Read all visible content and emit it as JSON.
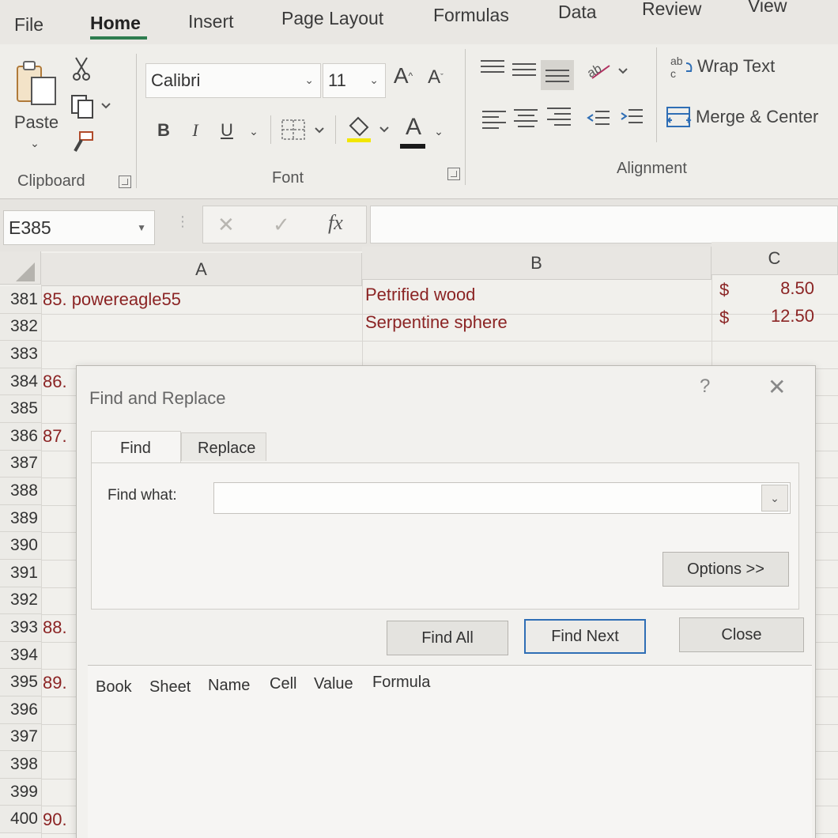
{
  "ribbon_tabs": [
    "File",
    "Home",
    "Insert",
    "Page Layout",
    "Formulas",
    "Data",
    "Review",
    "View"
  ],
  "clipboard": {
    "paste_label": "Paste",
    "group_label": "Clipboard"
  },
  "font": {
    "name": "Calibri",
    "size": "11",
    "bold": "B",
    "italic": "I",
    "underline": "U",
    "font_color_letter": "A",
    "grow_label": "A",
    "shrink_label": "A",
    "group_label": "Font"
  },
  "alignment": {
    "wrap_text": "Wrap Text",
    "merge_center": "Merge & Center",
    "group_label": "Alignment"
  },
  "formula_bar": {
    "name_box": "E385",
    "cancel": "✕",
    "enter": "✓",
    "fx": "fx"
  },
  "columns": [
    "A",
    "B",
    "C"
  ],
  "rows": [
    {
      "num": "381",
      "a": "85. powereagle55",
      "b": "Petrified wood",
      "c_sym": "$",
      "c_val": "8.50"
    },
    {
      "num": "382",
      "a": "",
      "b": "Serpentine sphere",
      "c_sym": "$",
      "c_val": "12.50"
    },
    {
      "num": "383",
      "a": "",
      "b": "",
      "c_sym": "",
      "c_val": ""
    },
    {
      "num": "384",
      "a": "86.",
      "b": "",
      "c_sym": "",
      "c_val": ""
    },
    {
      "num": "385",
      "a": "",
      "b": "",
      "c_sym": "",
      "c_val": ""
    },
    {
      "num": "386",
      "a": "87.",
      "b": "",
      "c_sym": "",
      "c_val": ""
    },
    {
      "num": "387",
      "a": "",
      "b": "",
      "c_sym": "",
      "c_val": ""
    },
    {
      "num": "388",
      "a": "",
      "b": "",
      "c_sym": "",
      "c_val": ""
    },
    {
      "num": "389",
      "a": "",
      "b": "",
      "c_sym": "",
      "c_val": ""
    },
    {
      "num": "390",
      "a": "",
      "b": "",
      "c_sym": "",
      "c_val": ""
    },
    {
      "num": "391",
      "a": "",
      "b": "",
      "c_sym": "",
      "c_val": ""
    },
    {
      "num": "392",
      "a": "",
      "b": "",
      "c_sym": "",
      "c_val": ""
    },
    {
      "num": "393",
      "a": "88.",
      "b": "",
      "c_sym": "",
      "c_val": ""
    },
    {
      "num": "394",
      "a": "",
      "b": "",
      "c_sym": "",
      "c_val": ""
    },
    {
      "num": "395",
      "a": "89.",
      "b": "",
      "c_sym": "",
      "c_val": ""
    },
    {
      "num": "396",
      "a": "",
      "b": "",
      "c_sym": "",
      "c_val": ""
    },
    {
      "num": "397",
      "a": "",
      "b": "",
      "c_sym": "",
      "c_val": ""
    },
    {
      "num": "398",
      "a": "",
      "b": "",
      "c_sym": "",
      "c_val": ""
    },
    {
      "num": "399",
      "a": "",
      "b": "",
      "c_sym": "",
      "c_val": ""
    },
    {
      "num": "400",
      "a": "90.",
      "b": "",
      "c_sym": "",
      "c_val": ""
    }
  ],
  "dialog": {
    "title": "Find and Replace",
    "help": "?",
    "close_x": "✕",
    "tabs": [
      "Find",
      "Replace"
    ],
    "find_what_label": "Find what:",
    "find_what_value": "",
    "options_button": "Options >>",
    "find_all": "Find All",
    "find_next": "Find Next",
    "close": "Close",
    "result_columns": [
      "Book",
      "Sheet",
      "Name",
      "Cell",
      "Value",
      "Formula"
    ]
  }
}
